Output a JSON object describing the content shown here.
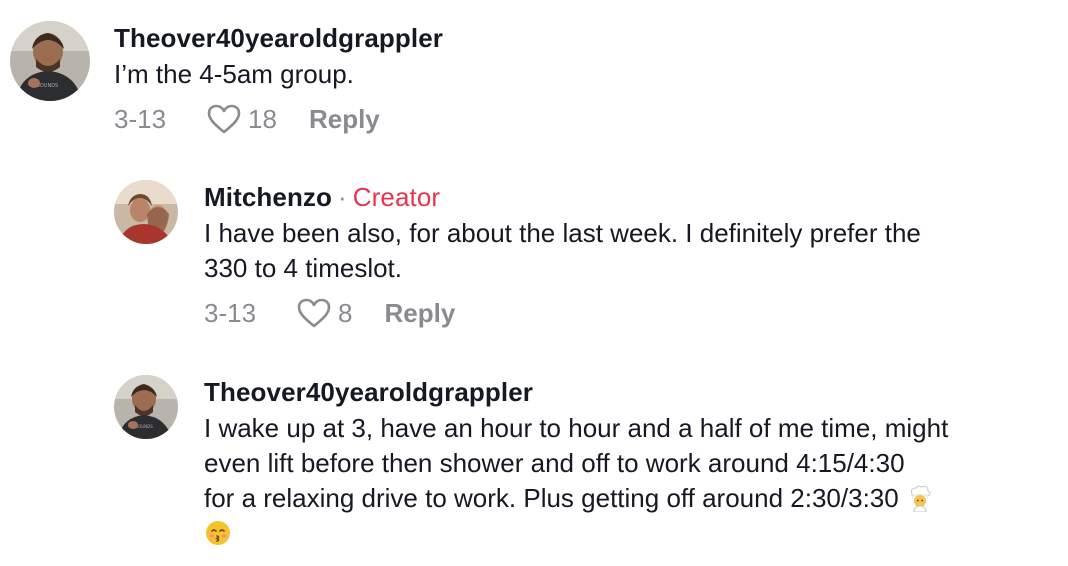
{
  "comments": [
    {
      "username": "Theover40yearoldgrappler",
      "text": "I’m the 4-5am group.",
      "date": "3-13",
      "likes": "18",
      "reply_label": "Reply"
    },
    {
      "username": "Mitchenzo",
      "separator": "·",
      "badge": "Creator",
      "text_line1": "I have been also, for about the last week. I definitely prefer the",
      "text_line2": "330 to 4 timeslot.",
      "date": "3-13",
      "likes": "8",
      "reply_label": "Reply"
    },
    {
      "username": "Theover40yearoldgrappler",
      "text_line1": "I wake up at 3, have an hour to hour and a half of me time, might",
      "text_line2": "even lift before then shower and off to work around 4:15/4:30",
      "text_line3": "for a relaxing drive to work. Plus getting off around 2:30/3:30",
      "emojis": [
        "cook-emoji",
        "kissing-face-emoji"
      ]
    }
  ],
  "colors": {
    "text": "#161823",
    "muted": "#8a8b91",
    "creator_badge": "#e8344e"
  }
}
